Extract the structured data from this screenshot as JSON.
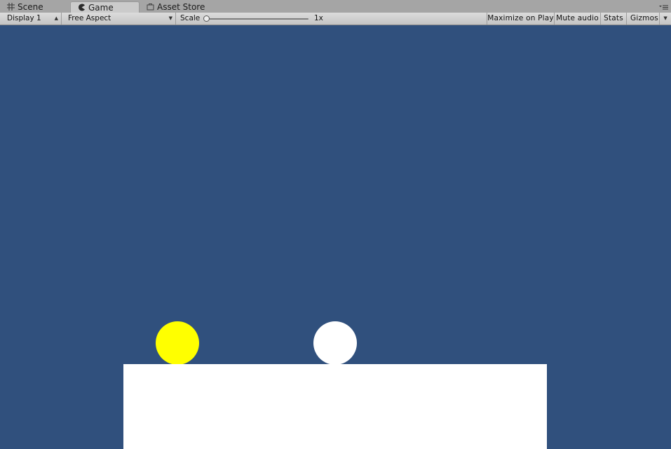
{
  "tabs": [
    {
      "label": "Scene",
      "icon": "scene-grid-icon",
      "active": false
    },
    {
      "label": "Game",
      "icon": "game-pacman-icon",
      "active": true
    },
    {
      "label": "Asset Store",
      "icon": "asset-store-bag-icon",
      "active": false
    }
  ],
  "toolbar": {
    "display_label": "Display 1",
    "aspect_label": "Free Aspect",
    "scale_label": "Scale",
    "scale_value": "1x",
    "scale_level": 0,
    "maximize_label": "Maximize on Play",
    "mute_label": "Mute audio",
    "stats_label": "Stats",
    "gizmos_label": "Gizmos"
  },
  "viewport": {
    "background_color": "#30507d",
    "objects": [
      {
        "name": "yellow-ball",
        "color": "#ffff00"
      },
      {
        "name": "white-ball",
        "color": "#ffffff"
      },
      {
        "name": "ground-platform",
        "color": "#ffffff"
      }
    ]
  },
  "colors": {
    "tab_bar": "#a5a5a5",
    "toolbar": "#cbcbcb",
    "active_tab": "#cbcbcb"
  }
}
